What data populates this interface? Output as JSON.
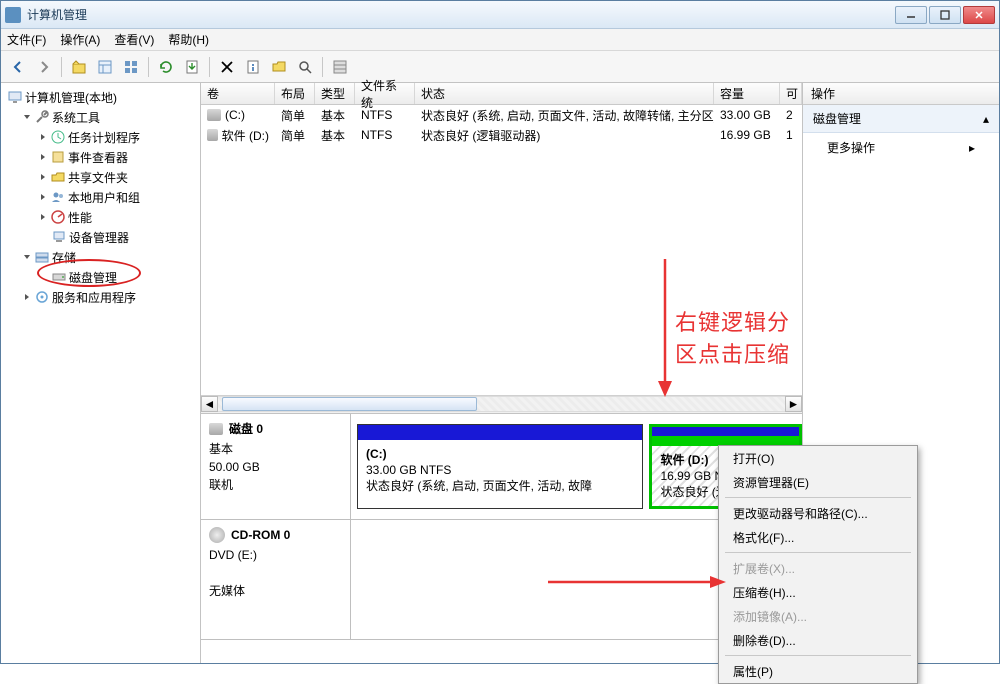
{
  "window": {
    "title": "计算机管理"
  },
  "menu": {
    "file": "文件(F)",
    "action": "操作(A)",
    "view": "查看(V)",
    "help": "帮助(H)"
  },
  "tree": {
    "root": "计算机管理(本地)",
    "sys": "系统工具",
    "task": "任务计划程序",
    "event": "事件查看器",
    "share": "共享文件夹",
    "users": "本地用户和组",
    "perf": "性能",
    "device": "设备管理器",
    "storage": "存储",
    "diskmgmt": "磁盘管理",
    "services": "服务和应用程序"
  },
  "grid": {
    "col_vol": "卷",
    "col_layout": "布局",
    "col_type": "类型",
    "col_fs": "文件系统",
    "col_status": "状态",
    "col_cap": "容量",
    "col_free": "可",
    "r1": {
      "vol": "(C:)",
      "layout": "简单",
      "type": "基本",
      "fs": "NTFS",
      "status": "状态良好 (系统, 启动, 页面文件, 活动, 故障转储, 主分区)",
      "cap": "33.00 GB",
      "free": "2"
    },
    "r2": {
      "vol": "软件 (D:)",
      "layout": "简单",
      "type": "基本",
      "fs": "NTFS",
      "status": "状态良好 (逻辑驱动器)",
      "cap": "16.99 GB",
      "free": "1"
    }
  },
  "disk0": {
    "title": "磁盘 0",
    "type": "基本",
    "size": "50.00 GB",
    "status": "联机",
    "p1_name": "(C:)",
    "p1_size": "33.00 GB NTFS",
    "p1_status": "状态良好 (系统, 启动, 页面文件, 活动, 故障",
    "p2_name": "软件   (D:)",
    "p2_size": "16.99 GB NTFS",
    "p2_status": "状态良好 (逻辑驱动器)"
  },
  "cdrom": {
    "title": "CD-ROM 0",
    "type": "DVD (E:)",
    "status": "无媒体"
  },
  "right": {
    "head": "操作",
    "group": "磁盘管理",
    "more": "更多操作"
  },
  "ctx": {
    "open": "打开(O)",
    "explorer": "资源管理器(E)",
    "change": "更改驱动器号和路径(C)...",
    "format": "格式化(F)...",
    "extend": "扩展卷(X)...",
    "shrink": "压缩卷(H)...",
    "mirror": "添加镜像(A)...",
    "delete": "删除卷(D)...",
    "prop": "属性(P)"
  },
  "anno": "右键逻辑分区点击压缩"
}
